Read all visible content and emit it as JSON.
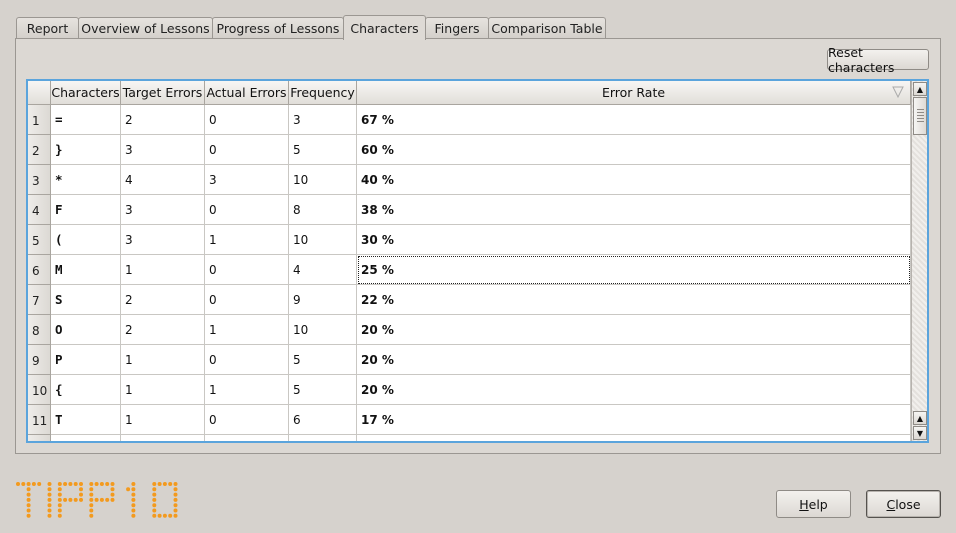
{
  "tabs": [
    {
      "label": "Report",
      "active": false
    },
    {
      "label": "Overview of Lessons",
      "active": false
    },
    {
      "label": "Progress of Lessons",
      "active": false
    },
    {
      "label": "Characters",
      "active": true
    },
    {
      "label": "Fingers",
      "active": false
    },
    {
      "label": "Comparison Table",
      "active": false
    }
  ],
  "reset_button": "Reset characters",
  "table": {
    "columns": [
      "Characters",
      "Target Errors",
      "Actual Errors",
      "Frequency",
      "Error Rate"
    ],
    "sort_column": "Error Rate",
    "sort_indicator": "sort-descending-icon",
    "rows": [
      {
        "n": "1",
        "char": "=",
        "target": "2",
        "actual": "0",
        "freq": "3",
        "rate": "67 %"
      },
      {
        "n": "2",
        "char": "}",
        "target": "3",
        "actual": "0",
        "freq": "5",
        "rate": "60 %"
      },
      {
        "n": "3",
        "char": "*",
        "target": "4",
        "actual": "3",
        "freq": "10",
        "rate": "40 %"
      },
      {
        "n": "4",
        "char": "F",
        "target": "3",
        "actual": "0",
        "freq": "8",
        "rate": "38 %"
      },
      {
        "n": "5",
        "char": "(",
        "target": "3",
        "actual": "1",
        "freq": "10",
        "rate": "30 %"
      },
      {
        "n": "6",
        "char": "M",
        "target": "1",
        "actual": "0",
        "freq": "4",
        "rate": "25 %",
        "focused": true
      },
      {
        "n": "7",
        "char": "S",
        "target": "2",
        "actual": "0",
        "freq": "9",
        "rate": "22 %"
      },
      {
        "n": "8",
        "char": "O",
        "target": "2",
        "actual": "1",
        "freq": "10",
        "rate": "20 %"
      },
      {
        "n": "9",
        "char": "P",
        "target": "1",
        "actual": "0",
        "freq": "5",
        "rate": "20 %"
      },
      {
        "n": "10",
        "char": "{",
        "target": "1",
        "actual": "1",
        "freq": "5",
        "rate": "20 %"
      },
      {
        "n": "11",
        "char": "T",
        "target": "1",
        "actual": "0",
        "freq": "6",
        "rate": "17 %"
      }
    ]
  },
  "logo_text": "TIPP10",
  "colors": {
    "accent": "#5ba4dc",
    "logo": "#f39a1e"
  },
  "buttons": {
    "help": {
      "mnemonic": "H",
      "rest": "elp"
    },
    "close": {
      "mnemonic": "C",
      "rest": "lose"
    }
  }
}
